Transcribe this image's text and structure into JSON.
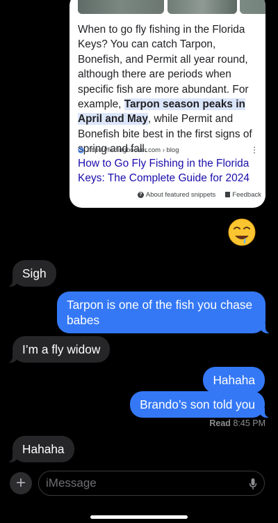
{
  "snippet": {
    "text_before": "When to go fly fishing in the Florida Keys? You can catch Tarpon, Bonefish, and Permit all year round, although there are periods when specific fish are more abundant. For example, ",
    "text_highlight": "Tarpon season peaks in April and May",
    "text_after": ", while Permit and Bonefish bite best in the first signs of spring and fall.",
    "source": "https://fishingbooker.com › blog",
    "link_title": "How to Go Fly Fishing in the Florida Keys: The Complete Guide for 2024",
    "about_label": "About featured snippets",
    "feedback_label": "Feedback",
    "more_icon": "⋮"
  },
  "reaction_emoji": "🤤",
  "messages": [
    {
      "dir": "in",
      "text": "Sigh"
    },
    {
      "dir": "out",
      "text": "Tarpon is one of the fish you chase babes"
    },
    {
      "dir": "in",
      "text": "I’m a fly widow"
    },
    {
      "dir": "out",
      "text": "Hahaha"
    },
    {
      "dir": "out",
      "text": "Brando’s son told you"
    },
    {
      "dir": "in",
      "text": "Hahaha"
    }
  ],
  "read_receipt": {
    "label": "Read",
    "time": "8:45 PM"
  },
  "composer": {
    "placeholder": "iMessage",
    "plus_icon": "+"
  },
  "colors": {
    "outgoing": "#3478f6",
    "incoming": "#262629",
    "link": "#1a0dab",
    "highlight": "#dce6fb"
  }
}
